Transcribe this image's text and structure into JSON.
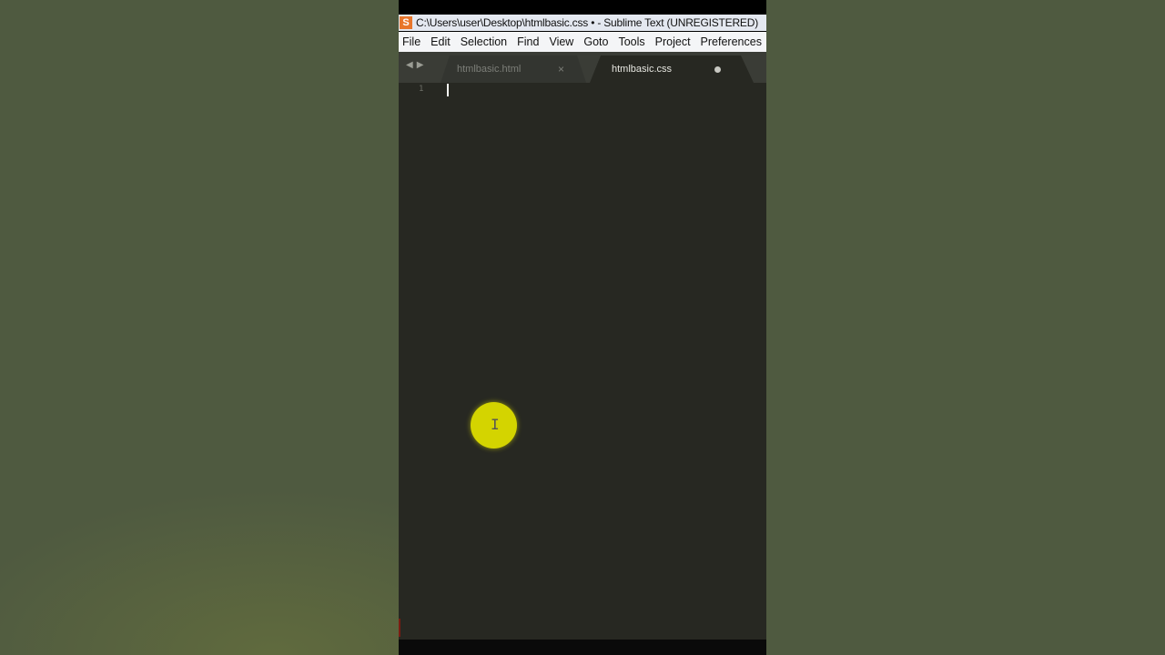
{
  "window": {
    "title": "C:\\Users\\user\\Desktop\\htmlbasic.css • - Sublime Text (UNREGISTERED)",
    "app_icon": "S"
  },
  "menu": {
    "items": [
      {
        "label": "File"
      },
      {
        "label": "Edit"
      },
      {
        "label": "Selection"
      },
      {
        "label": "Find"
      },
      {
        "label": "View"
      },
      {
        "label": "Goto"
      },
      {
        "label": "Tools"
      },
      {
        "label": "Project"
      },
      {
        "label": "Preferences"
      }
    ]
  },
  "tabs": [
    {
      "label": "htmlbasic.html",
      "active": false,
      "close_glyph": "×"
    },
    {
      "label": "htmlbasic.css",
      "active": true,
      "dirty": true
    }
  ],
  "editor": {
    "line_numbers": [
      "1"
    ],
    "content": ""
  },
  "colors": {
    "editor_bg": "#272822",
    "tab_bar_bg": "#3a3c36",
    "cursor_highlight": "#d4d400",
    "app_icon": "#e8762b",
    "page_bg": "#4f5a40"
  }
}
